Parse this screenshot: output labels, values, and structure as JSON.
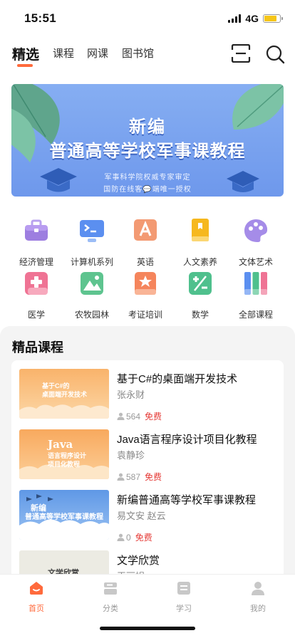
{
  "status_bar": {
    "time": "15:51",
    "network": "4G",
    "battery_level": 0.8,
    "battery_color": "#f5c518"
  },
  "top_tabs": [
    {
      "label": "精选",
      "active": true
    },
    {
      "label": "课程",
      "active": false
    },
    {
      "label": "网课",
      "active": false
    },
    {
      "label": "图书馆",
      "active": false
    }
  ],
  "top_actions": {
    "scan_icon": "scan-icon",
    "search_icon": "search-icon"
  },
  "banner": {
    "title_line1": "新编",
    "title_line2": "普通高等学校军事课教程",
    "subtitle_line1": "军事科学院权威专家审定",
    "subtitle_line2": "国防在线客💬端唯一授权"
  },
  "categories": [
    {
      "label": "经济管理",
      "icon": "briefcase-icon"
    },
    {
      "label": "计算机系列",
      "icon": "monitor-icon"
    },
    {
      "label": "英语",
      "icon": "letter-a-icon"
    },
    {
      "label": "人文素养",
      "icon": "book-icon"
    },
    {
      "label": "文体艺术",
      "icon": "palette-icon"
    },
    {
      "label": "医学",
      "icon": "medical-cross-icon"
    },
    {
      "label": "农牧园林",
      "icon": "landscape-icon"
    },
    {
      "label": "考证培训",
      "icon": "certificate-icon"
    },
    {
      "label": "数学",
      "icon": "math-icon"
    },
    {
      "label": "全部课程",
      "icon": "all-courses-icon"
    }
  ],
  "section": {
    "title": "精品课程"
  },
  "courses": [
    {
      "title": "基于C#的桌面端开发技术",
      "author": "张永财",
      "count": "564",
      "price": "免费",
      "thumb_line1": "基于C#的",
      "thumb_line2": "桌面端开发技术"
    },
    {
      "title": "Java语言程序设计项目化教程",
      "author": "袁静珍",
      "count": "587",
      "price": "免费",
      "thumb_line1": "Java",
      "thumb_line2": "语言程序设计",
      "thumb_line3": "项目化教程"
    },
    {
      "title": "新编普通高等学校军事课教程",
      "author": "易文安 赵云",
      "count": "0",
      "price": "免费",
      "thumb_line1": "新编",
      "thumb_line2": "普通高等学校军事课教程"
    },
    {
      "title": "文学欣赏",
      "author": "王丽娟",
      "thumb_line1": "文学欣赏"
    }
  ],
  "bottom_nav": [
    {
      "label": "首页",
      "icon": "home-icon",
      "active": true
    },
    {
      "label": "分类",
      "icon": "category-icon",
      "active": false
    },
    {
      "label": "学习",
      "icon": "study-icon",
      "active": false
    },
    {
      "label": "我的",
      "icon": "profile-icon",
      "active": false
    }
  ],
  "colors": {
    "accent": "#ff6a3c",
    "price": "#e53935",
    "banner_bg": "#7ea5ef"
  }
}
